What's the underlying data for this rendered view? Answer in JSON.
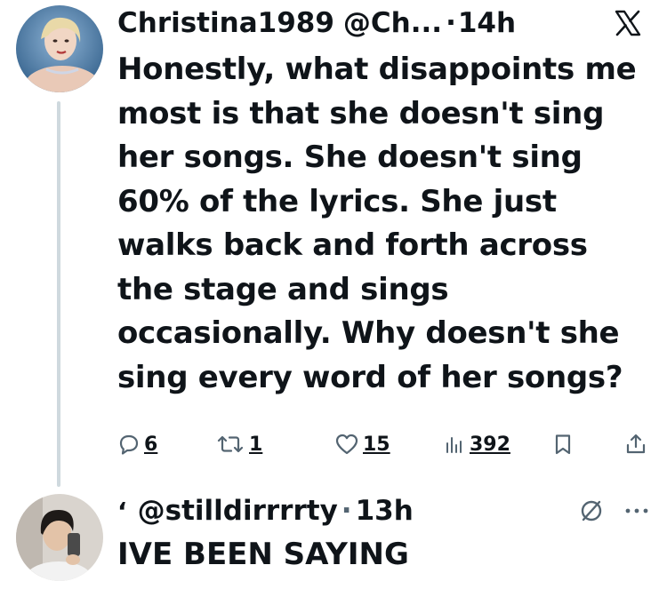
{
  "tweet": {
    "display_name": "Christina1989",
    "handle": "@Ch...",
    "separator": "·",
    "time": "14h",
    "text": "Honestly, what disappoints me most is that she doesn't sing her songs. She doesn't sing 60% of the lyrics. She just walks back and forth across the stage and sings occasionally. Why doesn't she sing every word of her songs?",
    "actions": {
      "replies": "6",
      "retweets": "1",
      "likes": "15",
      "views": "392"
    },
    "icons": [
      "avatar",
      "x-logo-icon",
      "reply-icon",
      "retweet-icon",
      "like-icon",
      "views-icon",
      "bookmark-icon",
      "share-icon"
    ]
  },
  "reply": {
    "mark": "‘",
    "handle": "@stilldirrrrty",
    "separator": "·",
    "time": "13h",
    "text": "IVE BEEN SAYING",
    "icons": [
      "avatar",
      "no-entry-icon",
      "more-icon"
    ]
  },
  "colors": {
    "text": "#0f1419",
    "muted": "#536471",
    "thread_line": "#cfd9de"
  }
}
